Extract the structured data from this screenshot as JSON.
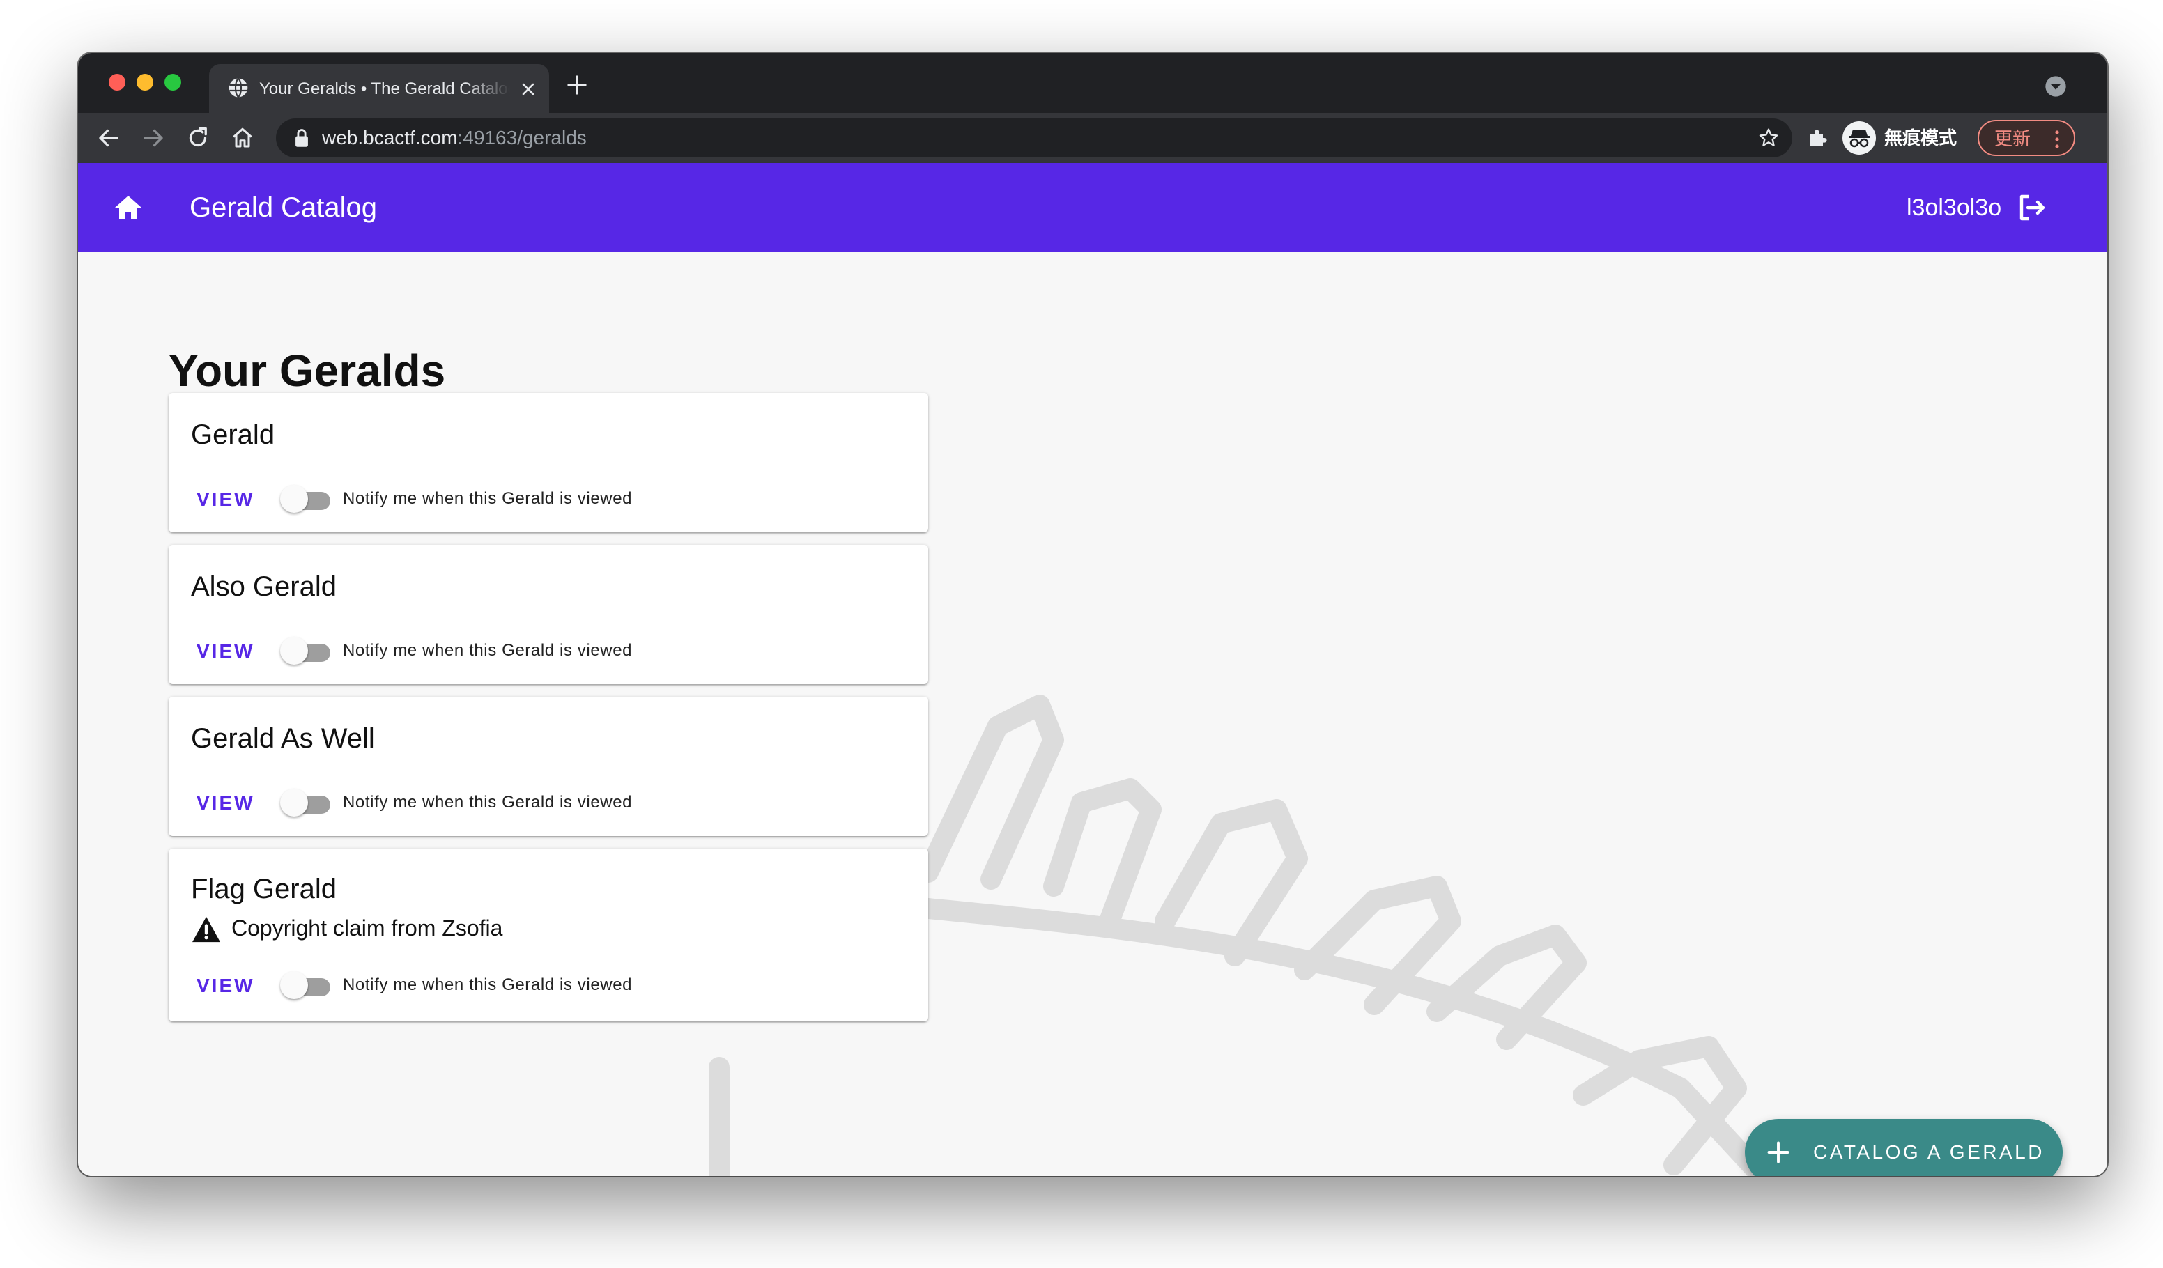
{
  "browser": {
    "tab": {
      "title": "Your Geralds • The Gerald Catalog"
    },
    "omnibox": {
      "url_host": "web.bcactf.com",
      "url_rest": ":49163/geralds"
    },
    "profile": {
      "label": "無痕模式"
    },
    "update": {
      "label": "更新"
    },
    "icons": [
      "globe-icon",
      "close-icon",
      "plus-icon",
      "chevron-down-icon",
      "back-arrow-icon",
      "forward-arrow-icon",
      "reload-icon",
      "home-icon",
      "lock-icon",
      "star-icon",
      "puzzle-icon",
      "incognito-icon",
      "more-vert-icon"
    ]
  },
  "appbar": {
    "title": "Gerald Catalog",
    "username": "l3ol3ol3o",
    "color": "#5727e6",
    "icons": [
      "home-icon",
      "logout-icon"
    ]
  },
  "main": {
    "title": "Your Geralds",
    "geralds": [
      {
        "name": "Gerald",
        "view_label": "VIEW",
        "notify_label": "Notify me when this Gerald is viewed",
        "notify_on": false
      },
      {
        "name": "Also Gerald",
        "view_label": "VIEW",
        "notify_label": "Notify me when this Gerald is viewed",
        "notify_on": false
      },
      {
        "name": "Gerald As Well",
        "view_label": "VIEW",
        "notify_label": "Notify me when this Gerald is viewed",
        "notify_on": false
      },
      {
        "name": "Flag Gerald",
        "warning": "Copyright claim from Zsofia",
        "warning_icon": "warning-icon",
        "view_label": "VIEW",
        "notify_label": "Notify me when this Gerald is viewed",
        "notify_on": false
      }
    ]
  },
  "fab": {
    "label": "CATALOG A GERALD",
    "icon": "plus-icon",
    "color": "#3a8a88"
  }
}
